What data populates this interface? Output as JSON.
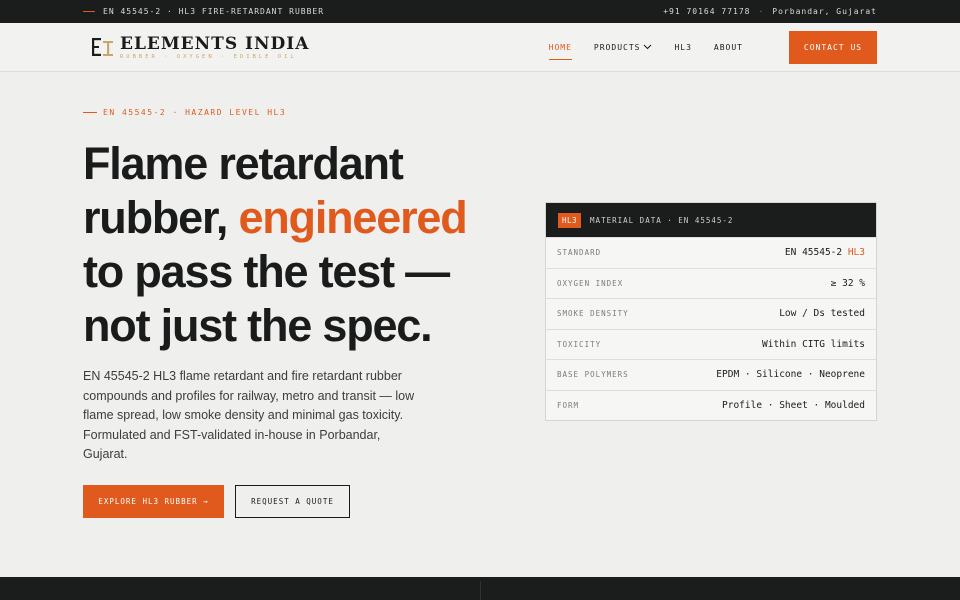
{
  "topbar": {
    "left_text": "EN 45545-2 · HL3 FIRE-RETARDANT RUBBER",
    "phone": "+91 70164 77178",
    "separator": "·",
    "location": "Porbandar, Gujarat"
  },
  "header": {
    "logo_mark": "EI",
    "logo_name": "ELEMENTS INDIA",
    "logo_tagline": "RUBBER · OXYGEN · EDIBLE OIL",
    "nav": [
      {
        "label": "HOME",
        "active": true
      },
      {
        "label": "PRODUCTS",
        "has_dropdown": true
      },
      {
        "label": "HL3"
      },
      {
        "label": "ABOUT"
      }
    ],
    "contact_label": "CONTACT US"
  },
  "hero": {
    "eyebrow": "EN 45545-2 · HAZARD LEVEL HL3",
    "headline_1": "Flame retardant",
    "headline_2a": "rubber, ",
    "headline_2b": "engineered",
    "headline_3": "to pass the test —",
    "headline_4": "not just the spec.",
    "lede": "EN 45545-2 HL3 flame retardant and fire retardant rubber compounds and profiles for railway, metro and transit — low flame spread, low smoke density and minimal gas toxicity. Formulated and FST-validated in-house in Porbandar, Gujarat.",
    "cta_primary": "EXPLORE HL3 RUBBER →",
    "cta_secondary": "REQUEST A QUOTE"
  },
  "card": {
    "badge": "HL3",
    "title": "MATERIAL DATA · EN 45545-2",
    "rows": [
      {
        "label": "STANDARD",
        "value": "EN 45545-2 ",
        "highlight": "HL3"
      },
      {
        "label": "OXYGEN INDEX",
        "value": "≥ 32 %"
      },
      {
        "label": "SMOKE DENSITY",
        "value": "Low / Ds tested"
      },
      {
        "label": "TOXICITY",
        "value": "Within CITG limits"
      },
      {
        "label": "BASE POLYMERS",
        "value": "EPDM · Silicone · Neoprene"
      },
      {
        "label": "FORM",
        "value": "Profile · Sheet · Moulded"
      }
    ]
  },
  "colors": {
    "accent": "#e05a1e",
    "dark": "#1b1d1d",
    "background": "#efefee",
    "tagline_gold": "#c8a86a"
  },
  "icons": {
    "dropdown": "chevron-down-icon",
    "arrow": "arrow-right-icon"
  }
}
